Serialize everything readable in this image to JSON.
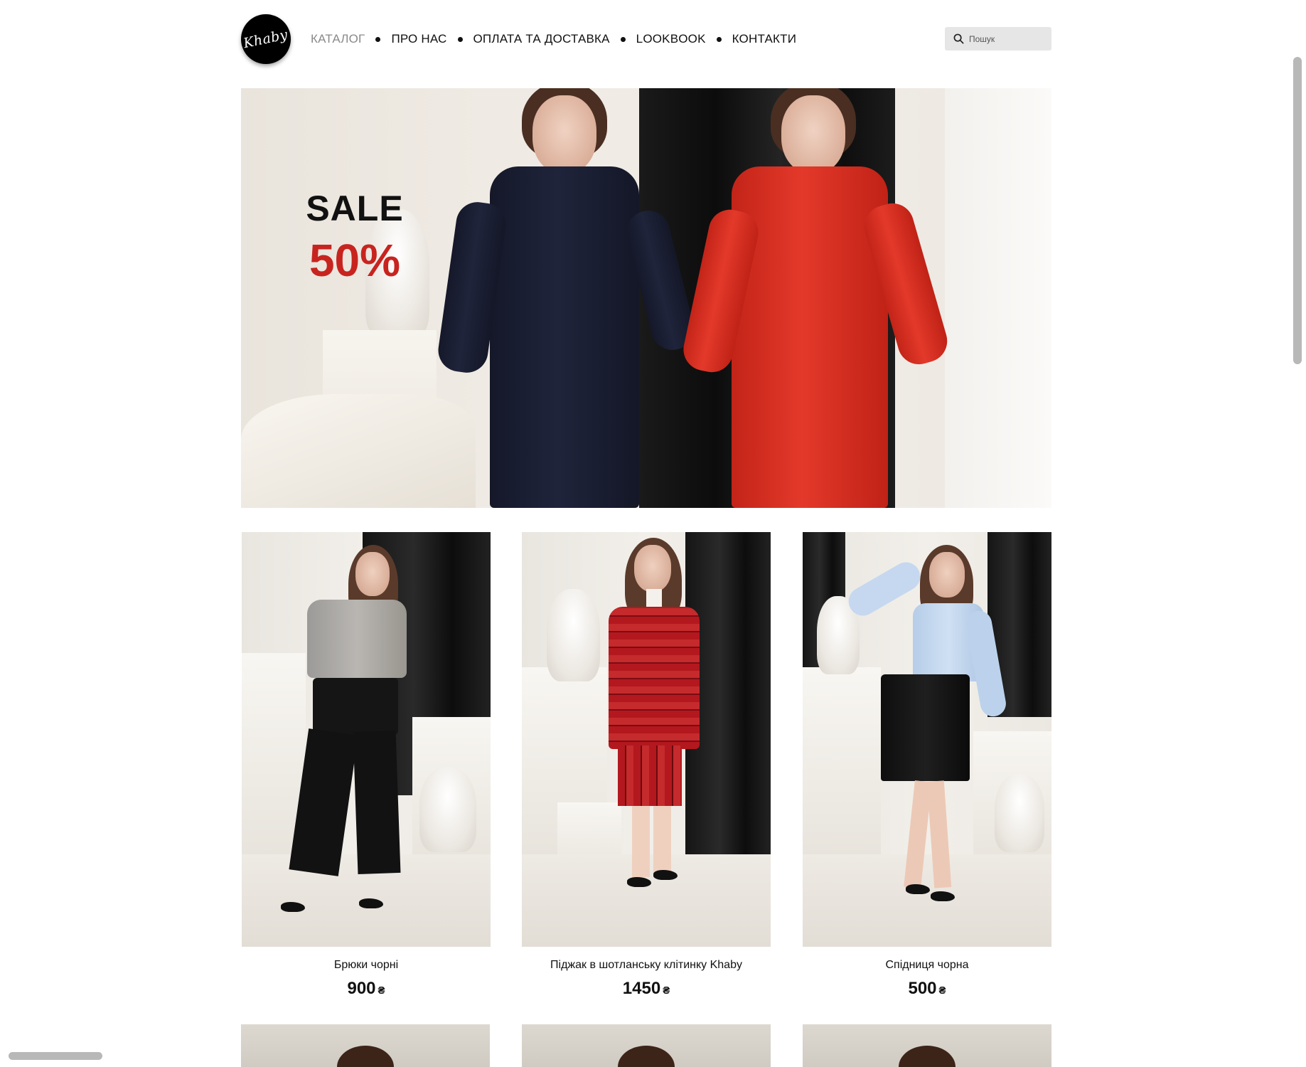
{
  "brand": {
    "logo_text": "Khaby"
  },
  "nav": {
    "items": [
      {
        "label": "КАТАЛОГ",
        "active": true
      },
      {
        "label": "ПРО НАС",
        "active": false
      },
      {
        "label": "ОПЛАТА ТА ДОСТАВКА",
        "active": false
      },
      {
        "label": "LOOKBOOK",
        "active": false
      },
      {
        "label": "КОНТАКТИ",
        "active": false
      }
    ]
  },
  "search": {
    "placeholder": "Пошук",
    "value": "",
    "icon": "search-icon"
  },
  "banner": {
    "title": "SALE",
    "discount": "50%",
    "colors": {
      "title": "#111111",
      "discount": "#c8241f"
    }
  },
  "products": [
    {
      "name": "Брюки чорні",
      "price": "900",
      "currency": "₴"
    },
    {
      "name": "Піджак в шотланську клітинку Khaby",
      "price": "1450",
      "currency": "₴"
    },
    {
      "name": "Спідниця чорна",
      "price": "500",
      "currency": "₴"
    }
  ]
}
